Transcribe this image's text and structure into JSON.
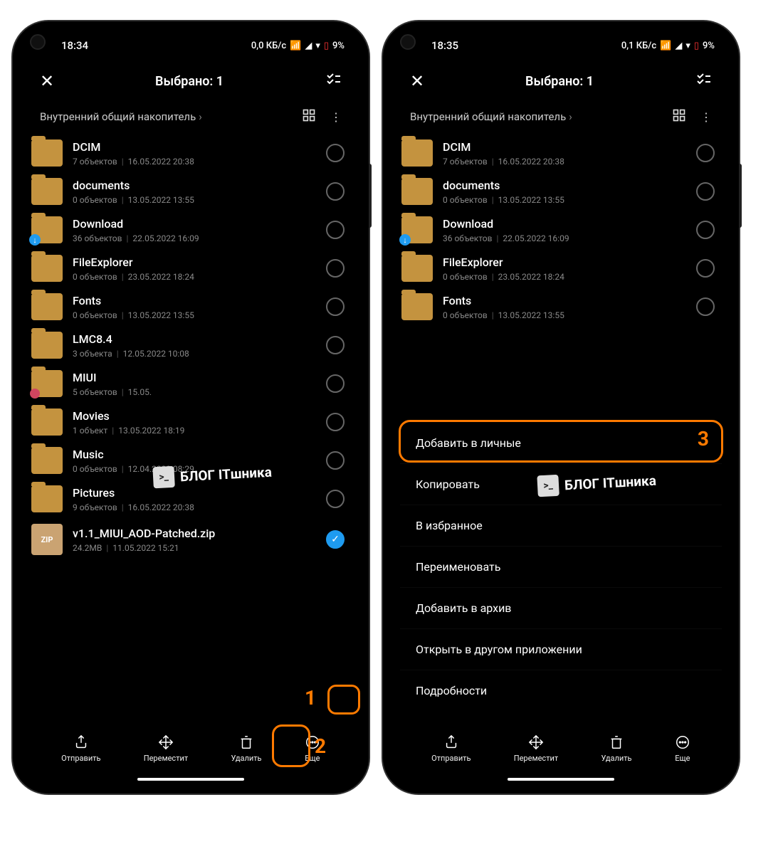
{
  "screens": [
    {
      "status": {
        "time": "18:34",
        "net_speed": "0,0 КБ/с",
        "battery": "9%"
      },
      "header": {
        "title": "Выбрано: 1"
      },
      "breadcrumb": "Внутренний общий накопитель",
      "selected_file": "v1.1_MIUI_AOD-Patched.zip"
    },
    {
      "status": {
        "time": "18:35",
        "net_speed": "0,1 КБ/с",
        "battery": "9%"
      },
      "header": {
        "title": "Выбрано: 1"
      },
      "breadcrumb": "Внутренний общий накопитель"
    }
  ],
  "folders": [
    {
      "name": "DCIM",
      "meta_count": "7 объектов",
      "meta_date": "16.05.2022 20:38",
      "variant": ""
    },
    {
      "name": "documents",
      "meta_count": "0 объектов",
      "meta_date": "13.05.2022 13:55",
      "variant": ""
    },
    {
      "name": "Download",
      "meta_count": "36 объектов",
      "meta_date": "22.05.2022 16:09",
      "variant": "dl"
    },
    {
      "name": "FileExplorer",
      "meta_count": "0 объектов",
      "meta_date": "23.05.2022 18:24",
      "variant": ""
    },
    {
      "name": "Fonts",
      "meta_count": "0 объектов",
      "meta_date": "13.05.2022 13:55",
      "variant": ""
    },
    {
      "name": "LMC8.4",
      "meta_count": "3 объекта",
      "meta_date": "12.05.2022 10:08",
      "variant": ""
    },
    {
      "name": "MIUI",
      "meta_count": "5 объектов",
      "meta_date": "15.05.",
      "variant": "mi"
    },
    {
      "name": "Movies",
      "meta_count": "1 объект",
      "meta_date": "13.05.2022 18:19",
      "variant": ""
    },
    {
      "name": "Music",
      "meta_count": "0 объектов",
      "meta_date": "12.04.2022 08:29",
      "variant": ""
    },
    {
      "name": "Pictures",
      "meta_count": "9 объектов",
      "meta_date": "16.05.2022 20:38",
      "variant": ""
    }
  ],
  "zip_file": {
    "icon": "ZIP",
    "name": "v1.1_MIUI_AOD-Patched.zip",
    "meta_size": "24.2MB",
    "meta_date": "11.05.2022 15:21",
    "selected": true
  },
  "bottom": {
    "send": "Отправить",
    "move": "Переместит",
    "delete": "Удалить",
    "more": "Еще"
  },
  "menu": {
    "add_private": "Добавить в личные",
    "copy": "Копировать",
    "favorites": "В избранное",
    "rename": "Переименовать",
    "archive": "Добавить в архив",
    "open_other": "Открыть в другом приложении",
    "details": "Подробности"
  },
  "annotations": {
    "n1": "1",
    "n2": "2",
    "n3": "3"
  },
  "watermark": "БЛОГ ITшника"
}
